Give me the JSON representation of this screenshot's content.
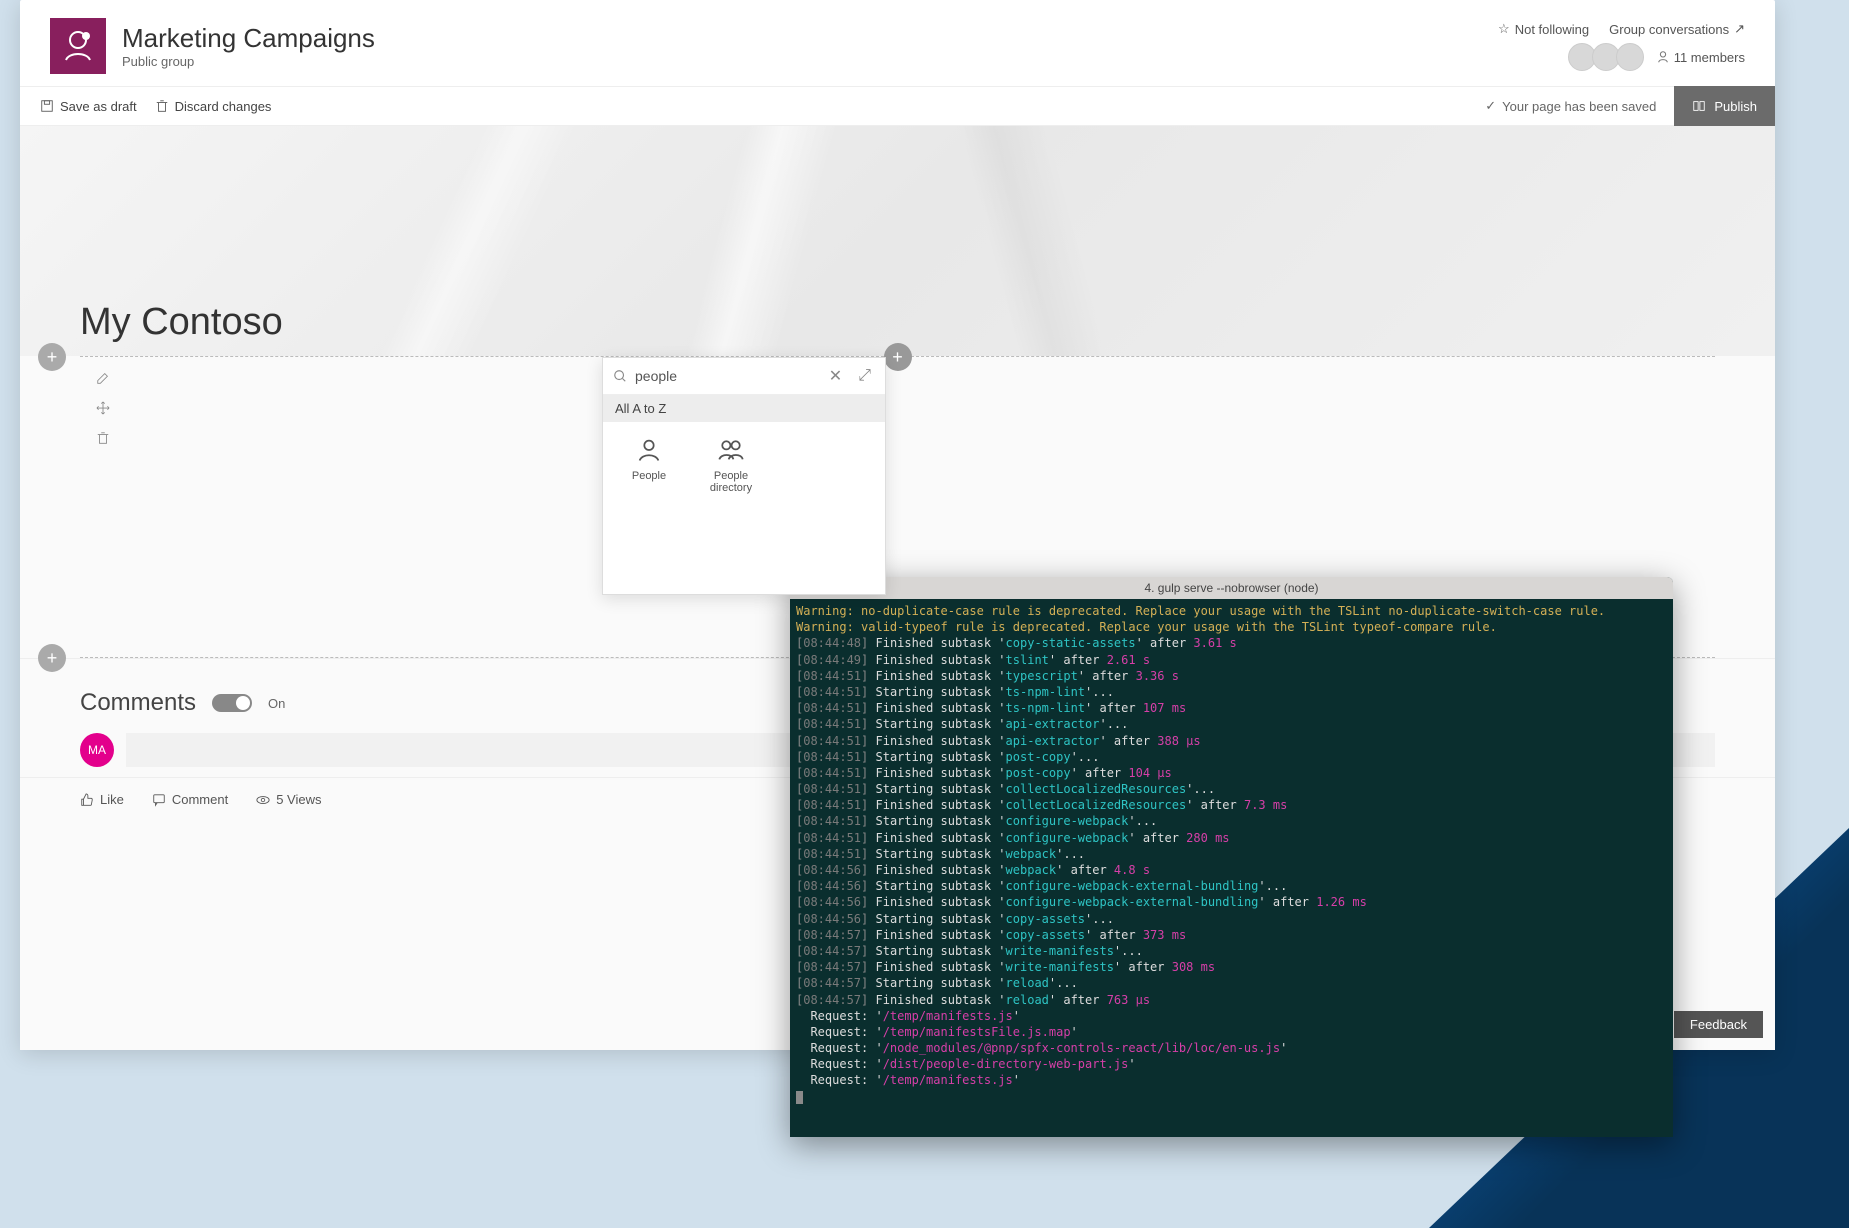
{
  "site": {
    "title": "Marketing Campaigns",
    "subtitle": "Public group"
  },
  "header": {
    "not_following": "Not following",
    "group_conv": "Group conversations",
    "members_count": "11 members"
  },
  "commandBar": {
    "save_draft": "Save as draft",
    "discard": "Discard changes",
    "saved_msg": "Your page has been saved",
    "publish": "Publish"
  },
  "page": {
    "hero_title": "My Contoso"
  },
  "toolbox": {
    "search_value": "people",
    "category": "All A to Z",
    "items": [
      {
        "label": "People"
      },
      {
        "label": "People directory"
      }
    ]
  },
  "comments": {
    "title": "Comments",
    "toggle_state": "On",
    "user_initials": "MA"
  },
  "pageActions": {
    "like": "Like",
    "comment": "Comment",
    "views": "5 Views"
  },
  "feedback": "Feedback",
  "terminal": {
    "title": "4. gulp serve --nobrowser (node)",
    "lines": [
      {
        "type": "warn",
        "text": "Warning: no-duplicate-case rule is deprecated. Replace your usage with the TSLint no-duplicate-switch-case rule."
      },
      {
        "type": "warn",
        "text": "Warning: valid-typeof rule is deprecated. Replace your usage with the TSLint typeof-compare rule."
      },
      {
        "type": "task",
        "time": "08:44:48",
        "verb": "Finished",
        "task": "copy-static-assets",
        "after": "3.61 s"
      },
      {
        "type": "task",
        "time": "08:44:49",
        "verb": "Finished",
        "task": "tslint",
        "after": "2.61 s"
      },
      {
        "type": "task",
        "time": "08:44:51",
        "verb": "Finished",
        "task": "typescript",
        "after": "3.36 s"
      },
      {
        "type": "task",
        "time": "08:44:51",
        "verb": "Starting",
        "task": "ts-npm-lint"
      },
      {
        "type": "task",
        "time": "08:44:51",
        "verb": "Finished",
        "task": "ts-npm-lint",
        "after": "107 ms"
      },
      {
        "type": "task",
        "time": "08:44:51",
        "verb": "Starting",
        "task": "api-extractor"
      },
      {
        "type": "task",
        "time": "08:44:51",
        "verb": "Finished",
        "task": "api-extractor",
        "after": "388 μs"
      },
      {
        "type": "task",
        "time": "08:44:51",
        "verb": "Starting",
        "task": "post-copy"
      },
      {
        "type": "task",
        "time": "08:44:51",
        "verb": "Finished",
        "task": "post-copy",
        "after": "104 μs"
      },
      {
        "type": "task",
        "time": "08:44:51",
        "verb": "Starting",
        "task": "collectLocalizedResources"
      },
      {
        "type": "task",
        "time": "08:44:51",
        "verb": "Finished",
        "task": "collectLocalizedResources",
        "after": "7.3 ms"
      },
      {
        "type": "task",
        "time": "08:44:51",
        "verb": "Starting",
        "task": "configure-webpack"
      },
      {
        "type": "task",
        "time": "08:44:51",
        "verb": "Finished",
        "task": "configure-webpack",
        "after": "280 ms"
      },
      {
        "type": "task",
        "time": "08:44:51",
        "verb": "Starting",
        "task": "webpack"
      },
      {
        "type": "task",
        "time": "08:44:56",
        "verb": "Finished",
        "task": "webpack",
        "after": "4.8 s"
      },
      {
        "type": "task",
        "time": "08:44:56",
        "verb": "Starting",
        "task": "configure-webpack-external-bundling"
      },
      {
        "type": "task",
        "time": "08:44:56",
        "verb": "Finished",
        "task": "configure-webpack-external-bundling",
        "after": "1.26 ms"
      },
      {
        "type": "task",
        "time": "08:44:56",
        "verb": "Starting",
        "task": "copy-assets"
      },
      {
        "type": "task",
        "time": "08:44:57",
        "verb": "Finished",
        "task": "copy-assets",
        "after": "373 ms"
      },
      {
        "type": "task",
        "time": "08:44:57",
        "verb": "Starting",
        "task": "write-manifests"
      },
      {
        "type": "task",
        "time": "08:44:57",
        "verb": "Finished",
        "task": "write-manifests",
        "after": "308 ms"
      },
      {
        "type": "task",
        "time": "08:44:57",
        "verb": "Starting",
        "task": "reload"
      },
      {
        "type": "task",
        "time": "08:44:57",
        "verb": "Finished",
        "task": "reload",
        "after": "763 μs"
      },
      {
        "type": "req",
        "path": "/temp/manifests.js"
      },
      {
        "type": "req",
        "path": "/temp/manifestsFile.js.map"
      },
      {
        "type": "req",
        "path": "/node_modules/@pnp/spfx-controls-react/lib/loc/en-us.js"
      },
      {
        "type": "req",
        "path": "/dist/people-directory-web-part.js"
      },
      {
        "type": "req",
        "path": "/temp/manifests.js"
      }
    ]
  }
}
